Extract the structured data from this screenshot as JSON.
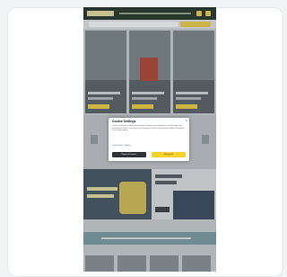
{
  "cookie_dialog": {
    "title": "Cookie Settings",
    "close_glyph": "×",
    "body": "We use cookies and similar technologies to improve your experience, analyse traffic and personalise content. You can accept all cookies or reject non-essential cookies. Read more in our cookie policy.",
    "link_label": "Cookie policy · Settings",
    "reject_label": "Reject all cookies",
    "accept_label": "Accept all"
  },
  "colors": {
    "header": "#2b3a2f",
    "accent_yellow": "#f5d22a",
    "dark_button": "#2f3236"
  },
  "icons": [
    "logo",
    "search-icon",
    "user-icon",
    "cart-icon",
    "close-icon"
  ]
}
